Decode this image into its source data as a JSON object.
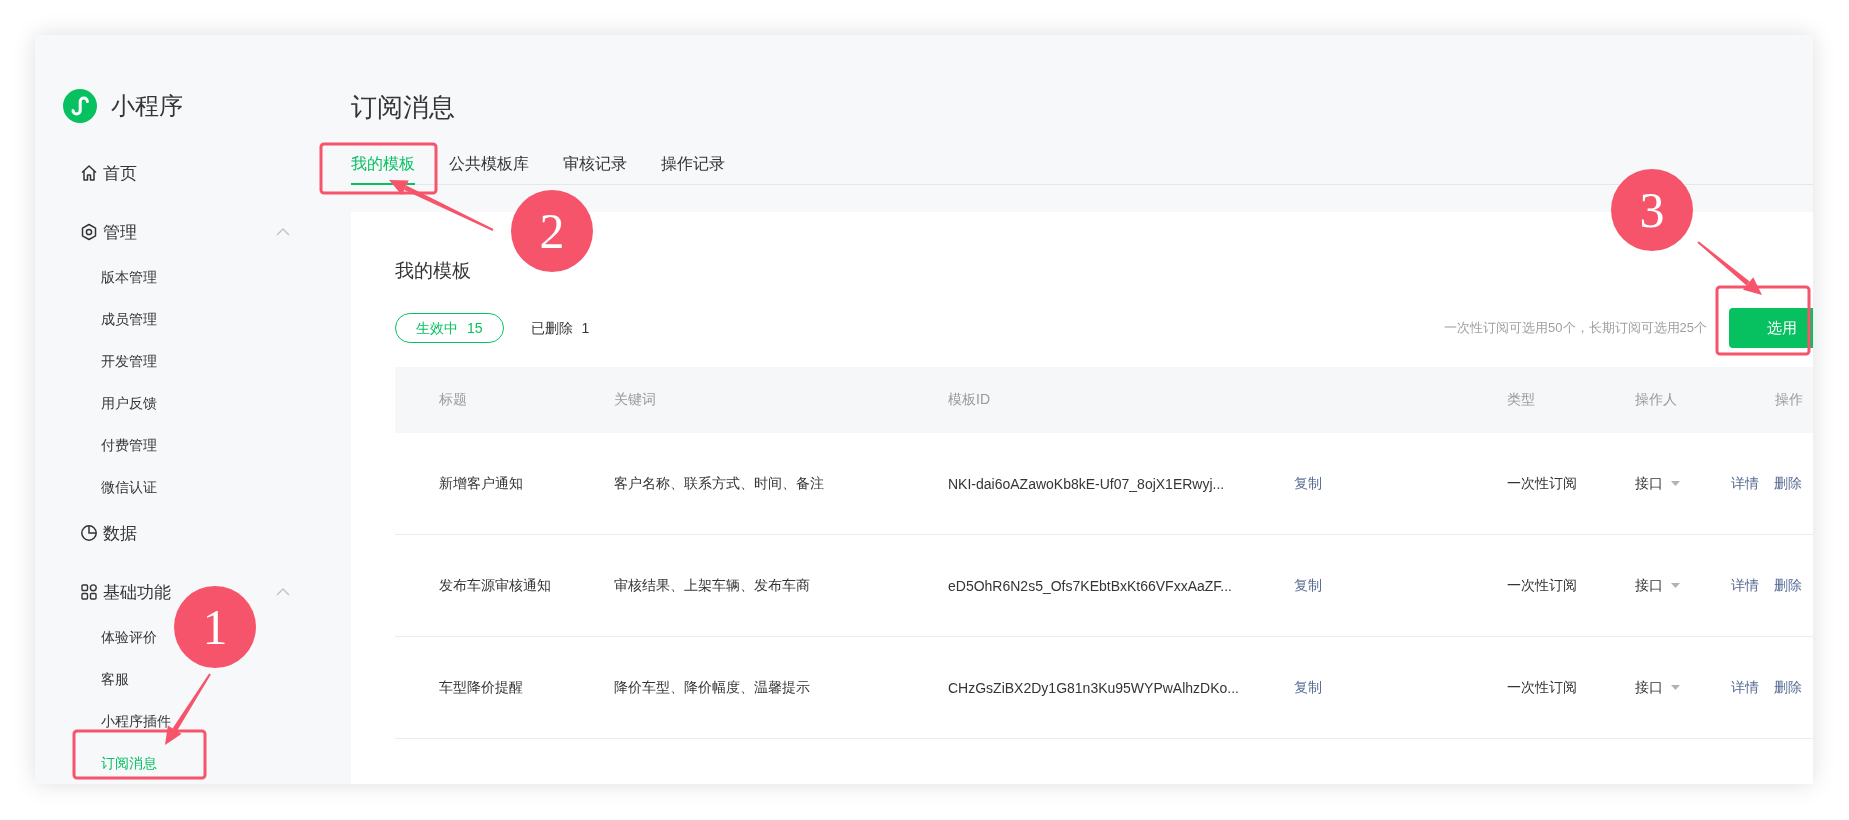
{
  "sidebar": {
    "logo_text": "小程序",
    "groups": [
      {
        "label": "首页"
      },
      {
        "label": "管理",
        "expanded": true,
        "children": [
          {
            "label": "版本管理",
            "selected": false
          },
          {
            "label": "成员管理",
            "selected": false
          },
          {
            "label": "开发管理",
            "selected": false
          },
          {
            "label": "用户反馈",
            "selected": false
          },
          {
            "label": "付费管理",
            "selected": false
          },
          {
            "label": "微信认证",
            "selected": false
          }
        ]
      },
      {
        "label": "数据"
      },
      {
        "label": "基础功能",
        "expanded": true,
        "children": [
          {
            "label": "体验评价",
            "selected": false
          },
          {
            "label": "客服",
            "selected": false
          },
          {
            "label": "小程序插件",
            "selected": false
          },
          {
            "label": "订阅消息",
            "selected": true
          }
        ]
      }
    ]
  },
  "page_title": "订阅消息",
  "tabs": [
    {
      "label": "我的模板",
      "selected": true
    },
    {
      "label": "公共模板库",
      "selected": false
    },
    {
      "label": "审核记录",
      "selected": false
    },
    {
      "label": "操作记录",
      "selected": false
    }
  ],
  "card": {
    "title": "我的模板",
    "filters": [
      {
        "label": "生效中",
        "count": "15",
        "selected": true
      },
      {
        "label": "已删除",
        "count": "1",
        "selected": false
      }
    ],
    "hint": "一次性订阅可选用50个，长期订阅可选用25个",
    "button": "选用"
  },
  "table": {
    "columns": [
      "标题",
      "关键词",
      "模板ID",
      "类型",
      "操作人",
      "操作"
    ],
    "rows": [
      {
        "title": "新增客户通知",
        "keywords": "客户名称、联系方式、时间、备注",
        "template_id": "NKI-dai6oAZawoKb8kE-Uf07_8ojX1ERwyj...",
        "copy": "复制",
        "type": "一次性订阅",
        "operator": "接口",
        "actions": [
          "详情",
          "删除"
        ]
      },
      {
        "title": "发布车源审核通知",
        "keywords": "审核结果、上架车辆、发布车商",
        "template_id": "eD5OhR6N2s5_Ofs7KEbtBxKt66VFxxAaZF...",
        "copy": "复制",
        "type": "一次性订阅",
        "operator": "接口",
        "actions": [
          "详情",
          "删除"
        ]
      },
      {
        "title": "车型降价提醒",
        "keywords": "降价车型、降价幅度、温馨提示",
        "template_id": "CHzGsZiBX2Dy1G81n3Ku95WYPwAlhzDKo...",
        "copy": "复制",
        "type": "一次性订阅",
        "operator": "接口",
        "actions": [
          "详情",
          "删除"
        ]
      }
    ]
  },
  "annotations": [
    {
      "number": "1"
    },
    {
      "number": "2"
    },
    {
      "number": "3"
    }
  ]
}
